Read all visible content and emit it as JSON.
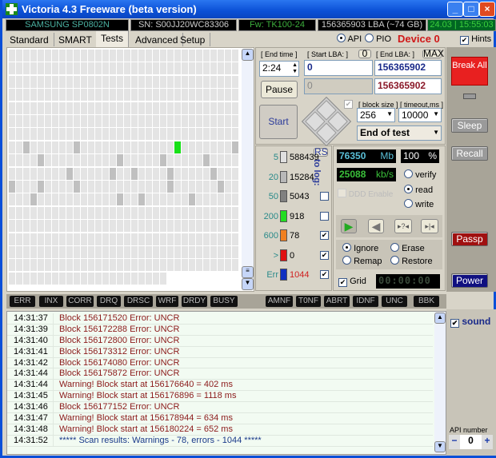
{
  "window": {
    "title": "Victoria 4.3 Freeware (beta version)",
    "controls": [
      "_",
      "□",
      "×"
    ]
  },
  "info": {
    "model": "SAMSUNG SP0802N",
    "serial": "SN: S00JJ20WC83306",
    "firmware": "Fw: TK100-24",
    "lba": "156365903 LBA (~74 GB)",
    "datetime": "24.03 | 15:55:03"
  },
  "tabs": [
    {
      "label": "Standard"
    },
    {
      "label": "SMART"
    },
    {
      "label": "Tests",
      "active": true
    },
    {
      "label": "Advanced"
    },
    {
      "label": "Setup"
    }
  ],
  "mode": {
    "api": "API",
    "pio": "PIO",
    "selected": "API",
    "device": "Device 0",
    "hints": "Hints",
    "hints_checked": true
  },
  "controls": {
    "end_time_label": "[ End time ]",
    "end_time": "2:24",
    "start_lba_label": "[ Start LBA: ]",
    "start_lba_zero": "0",
    "start_lba": "0",
    "start_lba_2": "0",
    "end_lba_label": "[ End LBA: ]",
    "end_lba_max": "MAX",
    "end_lba": "156365902",
    "end_lba_2": "156365902",
    "pause": "Pause",
    "start": "Start",
    "block_size_label": "[ block size ]",
    "block_size": "256",
    "timeout_label": "[ timeout,ms ]",
    "timeout": "10000",
    "end_action": "End of test"
  },
  "stats": {
    "rs": "RS",
    "to_log": "to log:",
    "rows": [
      {
        "threshold": "5",
        "count": "588439",
        "color": "#e0e0e0",
        "log": null
      },
      {
        "threshold": "20",
        "count": "15284",
        "color": "#b8b8b8",
        "log": null
      },
      {
        "threshold": "50",
        "count": "5043",
        "color": "#808080",
        "log": false
      },
      {
        "threshold": "200",
        "count": "918",
        "color": "#22dd22",
        "log": false
      },
      {
        "threshold": "600",
        "count": "78",
        "color": "#f08020",
        "log": true
      },
      {
        "threshold": ">",
        "count": "0",
        "color": "#e01010",
        "log": true
      },
      {
        "threshold": "Err",
        "count": "1044",
        "color": "#1030c0",
        "log": true
      }
    ]
  },
  "readout": {
    "mb": "76350",
    "mb_unit": "Mb",
    "percent": "100",
    "percent_unit": "%",
    "speed": "25088",
    "speed_unit": "kb/s",
    "ddd": "DDD Enable",
    "timer": "00:00:00",
    "progress_percent": 100
  },
  "test_mode": {
    "options": [
      "verify",
      "read",
      "write"
    ],
    "selected": "read"
  },
  "repair_mode": {
    "options": [
      "Ignore",
      "Erase",
      "Remap",
      "Restore"
    ],
    "selected": "Ignore"
  },
  "grid": {
    "label": "Grid",
    "checked": true
  },
  "side": {
    "break_all": "Break All",
    "sleep": "Sleep",
    "recall": "Recall",
    "passp": "Passp",
    "power": "Power",
    "sound": "sound",
    "api_number_label": "API number",
    "api_number": "0",
    "minus": "−",
    "plus": "+"
  },
  "status_flags": [
    "ERR",
    "INX",
    "CORR",
    "DRQ",
    "DRSC",
    "WRF",
    "DRDY",
    "BUSY",
    "AMNF",
    "T0NF",
    "ABRT",
    "IDNF",
    "UNC",
    "BBK"
  ],
  "log": [
    {
      "time": "14:31:37",
      "msg": "Block 156171520 Error: UNCR"
    },
    {
      "time": "14:31:39",
      "msg": "Block 156172288 Error: UNCR"
    },
    {
      "time": "14:31:40",
      "msg": "Block 156172800 Error: UNCR"
    },
    {
      "time": "14:31:41",
      "msg": "Block 156173312 Error: UNCR"
    },
    {
      "time": "14:31:42",
      "msg": "Block 156174080 Error: UNCR"
    },
    {
      "time": "14:31:44",
      "msg": "Block 156175872 Error: UNCR"
    },
    {
      "time": "14:31:44",
      "msg": "Warning! Block start at 156176640 = 402 ms"
    },
    {
      "time": "14:31:45",
      "msg": "Warning! Block start at 156176896 = 1118 ms"
    },
    {
      "time": "14:31:46",
      "msg": "Block 156177152 Error: UNCR"
    },
    {
      "time": "14:31:47",
      "msg": "Warning! Block start at 156178944 = 634 ms"
    },
    {
      "time": "14:31:48",
      "msg": "Warning! Block start at 156180224 = 652 ms"
    },
    {
      "time": "14:31:52",
      "msg": "***** Scan results: Warnings - 78, errors - 1044 *****",
      "type": "summary"
    }
  ]
}
